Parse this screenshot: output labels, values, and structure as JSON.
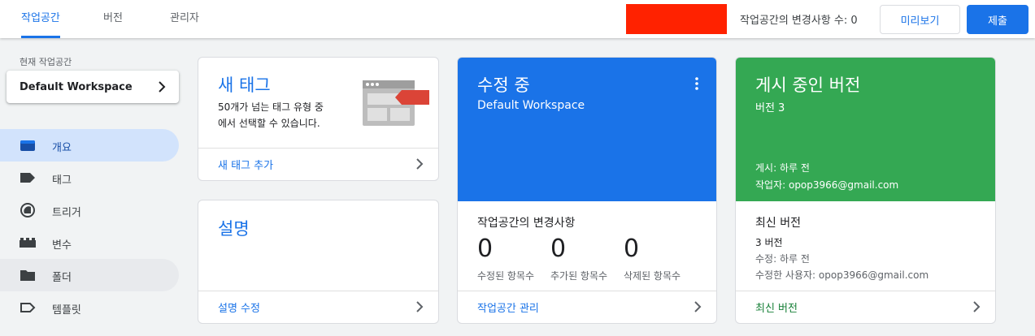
{
  "topbar": {
    "tabs": [
      "작업공간",
      "버전",
      "관리자"
    ],
    "changes_text": "작업공간의 변경사항 수: 0",
    "preview_label": "미리보기",
    "submit_label": "제출"
  },
  "sidebar": {
    "workspace_label": "현재 작업공간",
    "workspace_name": "Default Workspace",
    "items": [
      {
        "label": "개요",
        "icon": "overview-icon"
      },
      {
        "label": "태그",
        "icon": "tag-icon"
      },
      {
        "label": "트리거",
        "icon": "trigger-icon"
      },
      {
        "label": "변수",
        "icon": "variable-icon"
      },
      {
        "label": "폴더",
        "icon": "folder-icon"
      },
      {
        "label": "템플릿",
        "icon": "template-icon"
      }
    ]
  },
  "new_tag": {
    "title": "새 태그",
    "desc_line1": "50개가 넘는 태그 유형 중",
    "desc_line2": "에서 선택할 수 있습니다.",
    "link": "새 태그 추가"
  },
  "description": {
    "title": "설명",
    "link": "설명 수정"
  },
  "editing": {
    "title": "수정 중",
    "workspace": "Default Workspace",
    "changes_title": "작업공간의 변경사항",
    "stats": [
      {
        "value": "0",
        "label": "수정된 항목수"
      },
      {
        "value": "0",
        "label": "추가된 항목수"
      },
      {
        "value": "0",
        "label": "삭제된 항목수"
      }
    ],
    "link": "작업공간 관리"
  },
  "published": {
    "title": "게시 중인 버전",
    "version": "버전 3",
    "published_at": "게시: 하루 전",
    "author": "작업자: opop3966@gmail.com",
    "latest_title": "최신 버전",
    "latest_version": "3 버전",
    "modified": "수정: 하루 전",
    "modifier": "수정한 사용자: opop3966@gmail.com",
    "link": "최신 버전"
  },
  "colors": {
    "accent": "#1a73e8",
    "editing_bg": "#1a73e8",
    "published_bg": "#34a853",
    "redacted": "#ff2200"
  }
}
